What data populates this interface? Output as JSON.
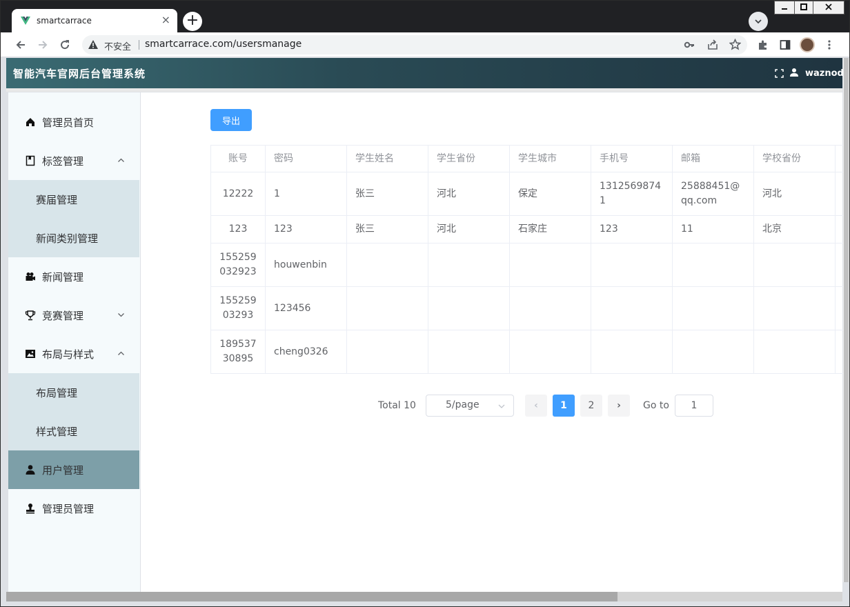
{
  "browser": {
    "tab_title": "smartcarrace",
    "tab_close": "×",
    "new_tab": "+",
    "security_label": "不安全",
    "url": "smartcarrace.com/usersmanage"
  },
  "header": {
    "title": "智能汽车官网后台管理系统",
    "username": "waznods"
  },
  "sidebar": {
    "items": [
      {
        "label": "管理员首页",
        "icon": "home-icon"
      },
      {
        "label": "标签管理",
        "icon": "bookmark-icon",
        "arrow": "^"
      },
      {
        "label": "赛届管理"
      },
      {
        "label": "新闻类别管理"
      },
      {
        "label": "新闻管理",
        "icon": "camera-icon"
      },
      {
        "label": "竞赛管理",
        "icon": "trophy-icon",
        "arrow": "v"
      },
      {
        "label": "布局与样式",
        "icon": "picture-icon",
        "arrow": "^"
      },
      {
        "label": "布局管理"
      },
      {
        "label": "样式管理"
      },
      {
        "label": "用户管理",
        "icon": "user-icon"
      },
      {
        "label": "管理员管理",
        "icon": "stamp-icon"
      }
    ],
    "active": "用户管理"
  },
  "main": {
    "export_label": "导出",
    "columns": [
      "账号",
      "密码",
      "学生姓名",
      "学生省份",
      "学生城市",
      "手机号",
      "邮箱",
      "学校省份"
    ],
    "rows": [
      [
        "12222",
        "1",
        "张三",
        "河北",
        "保定",
        "13125698741",
        "25888451@qq.com",
        "河北"
      ],
      [
        "123",
        "123",
        "张三",
        "河北",
        "石家庄",
        "123",
        "11",
        "北京"
      ],
      [
        "155259032923",
        "houwenbin",
        "",
        "",
        "",
        "",
        "",
        ""
      ],
      [
        "15525903293",
        "123456",
        "",
        "",
        "",
        "",
        "",
        ""
      ],
      [
        "18953730895",
        "cheng0326",
        "",
        "",
        "",
        "",
        "",
        ""
      ]
    ]
  },
  "pagination": {
    "total_label": "Total 10",
    "page_size": "5/page",
    "prev": "‹",
    "next": "›",
    "pages": [
      "1",
      "2"
    ],
    "current_page": "1",
    "goto_label": "Go to",
    "goto_value": "1"
  },
  "colors": {
    "primary": "#409eff",
    "header_gradient_start": "#3a6b73",
    "active_menu": "#7d9fa8",
    "submenu_bg": "#d8e5ea"
  }
}
